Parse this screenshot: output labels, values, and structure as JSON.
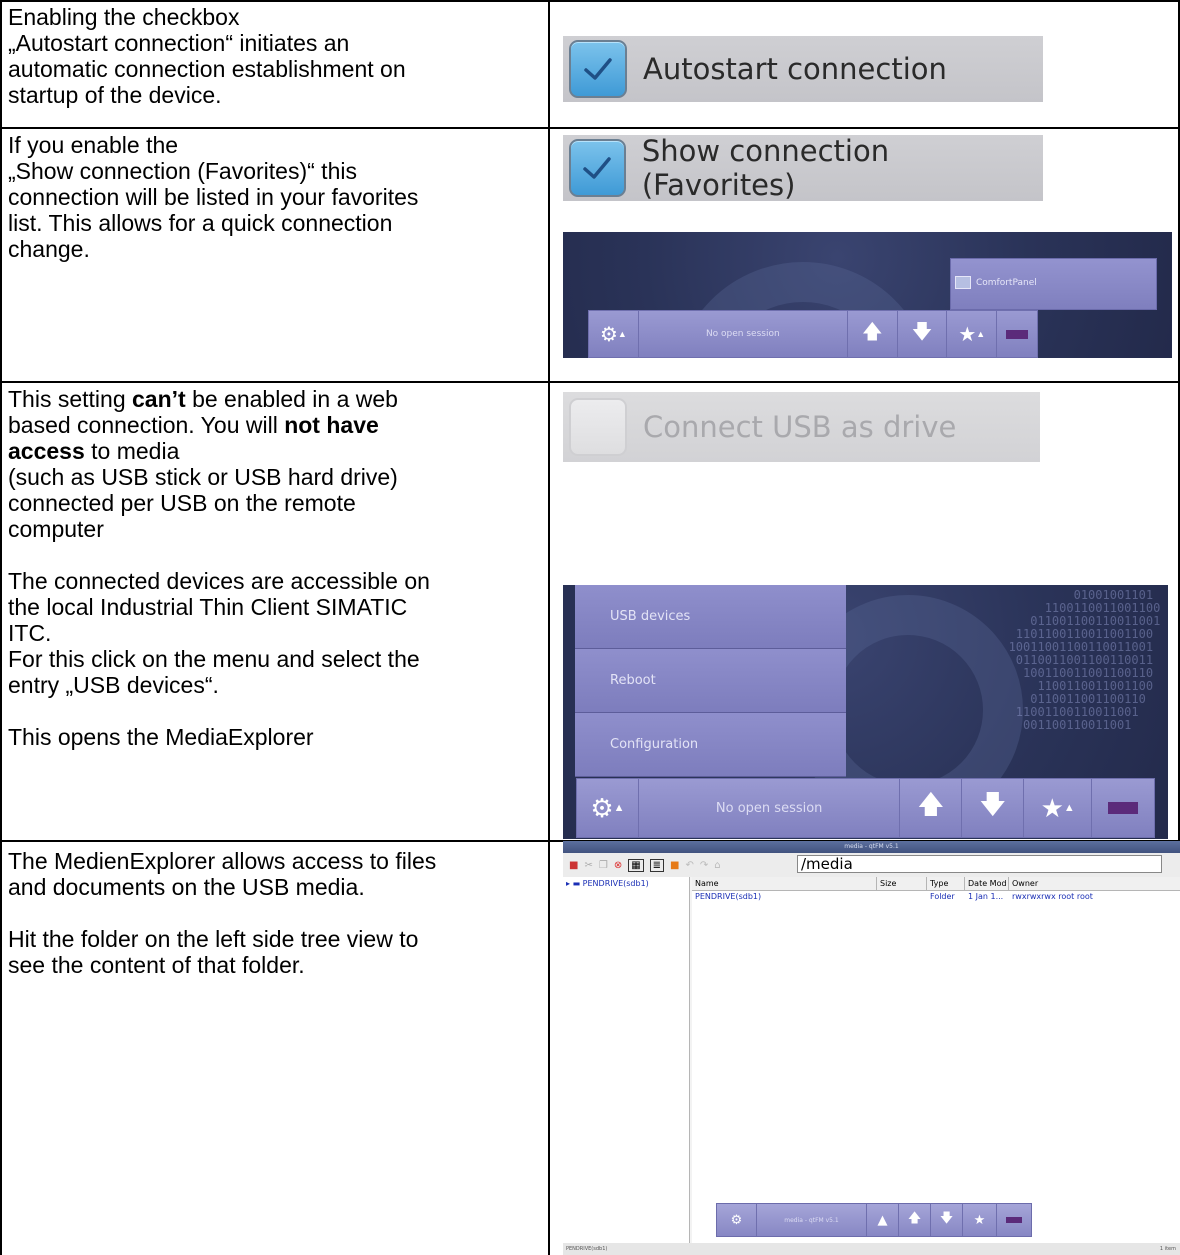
{
  "rows": [
    {
      "text_lines": [
        "Enabling the checkbox",
        "„Autostart connection“ initiates an",
        "automatic connection establishment on",
        "startup of the device."
      ],
      "checkbox": {
        "label": "Autostart connection",
        "checked": true
      }
    },
    {
      "text_lines": [
        "If you enable the",
        "„Show connection (Favorites)“ this",
        "connection will be listed in your favorites",
        "list. This allows for a quick connection",
        "change."
      ],
      "checkbox": {
        "label": "Show connection (Favorites)",
        "checked": true
      },
      "favorites_panel": {
        "favorite_item": "ComfortPanel",
        "session_text": "No open session"
      }
    },
    {
      "text_before_bold1": "This setting ",
      "bold1": "can’t",
      "text_after_bold1": " be enabled in a web",
      "line2_before": "based connection. You will ",
      "bold2_a": "not have",
      "bold2_b": "access",
      "line3_after": " to media",
      "lines_rest": [
        "(such as USB stick or USB hard drive)",
        "connected per USB on the remote",
        "computer"
      ],
      "para2": [
        "The connected devices are accessible on",
        "the local Industrial Thin Client SIMATIC",
        "ITC.",
        "For this click on the menu and select the",
        "entry „USB devices“."
      ],
      "para3": "This opens the MediaExplorer",
      "checkbox": {
        "label": "Connect USB as drive",
        "checked": false
      },
      "menu_panel": {
        "items": [
          "USB devices",
          "Reboot",
          "Configuration"
        ],
        "session_text": "No open session"
      }
    },
    {
      "para1": [
        "The MedienExplorer allows access to files",
        "and documents on the USB media."
      ],
      "para2": [
        "Hit the folder on the left side tree view to",
        "see the content of that folder."
      ],
      "media_explorer": {
        "title": "media - qtFM v5.1",
        "path": "/media",
        "tree_item": "PENDRIVE(sdb1)",
        "columns": [
          "Name",
          "Size",
          "Type",
          "Date Mod",
          "Owner"
        ],
        "files": [
          {
            "name": "PENDRIVE(sdb1)",
            "size": "",
            "type": "Folder",
            "date": "1 Jan 1...",
            "owner": "rwxrwxrwx root root"
          }
        ],
        "status_left": "PENDRIVE(sdb1)",
        "status_right": "1 item",
        "taskbar_label": "media - qtFM v5.1"
      }
    }
  ],
  "colors": {
    "checkbox_checked": "#4aa3dc",
    "panel_dark": "#2a3358",
    "toolbar": "#8a8ac8",
    "folder_link": "#1a2fb5"
  }
}
